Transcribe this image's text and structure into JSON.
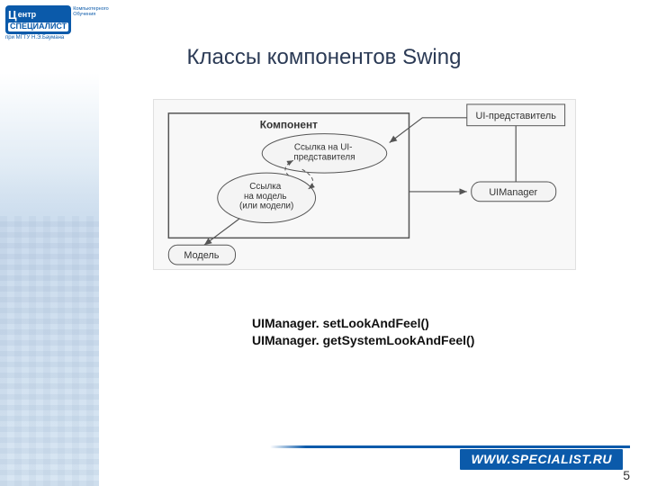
{
  "logo": {
    "big_letter": "Ц",
    "word_rest": "ентр",
    "top_small": "Компьютерного\nОбучения",
    "specialist": "СПЕЦИАЛИСТ",
    "sub": "при МГТУ  Н.Э.Баумана"
  },
  "title": "Классы компонентов Swing",
  "diagram": {
    "component_box": "Компонент",
    "ui_delegate": "UI-представитель",
    "ref_to_ui": "Ссылка на UI-\nпредставителя",
    "ref_to_model": "Ссылка\nна модель\n(или модели)",
    "ui_manager": "UIManager",
    "model": "Модель"
  },
  "code": {
    "line1": "UIManager. setLookAndFeel()",
    "line2": "UIManager. getSystemLookAndFeel()"
  },
  "footer": {
    "url": "WWW.SPECIALIST.RU"
  },
  "page_number": "5"
}
